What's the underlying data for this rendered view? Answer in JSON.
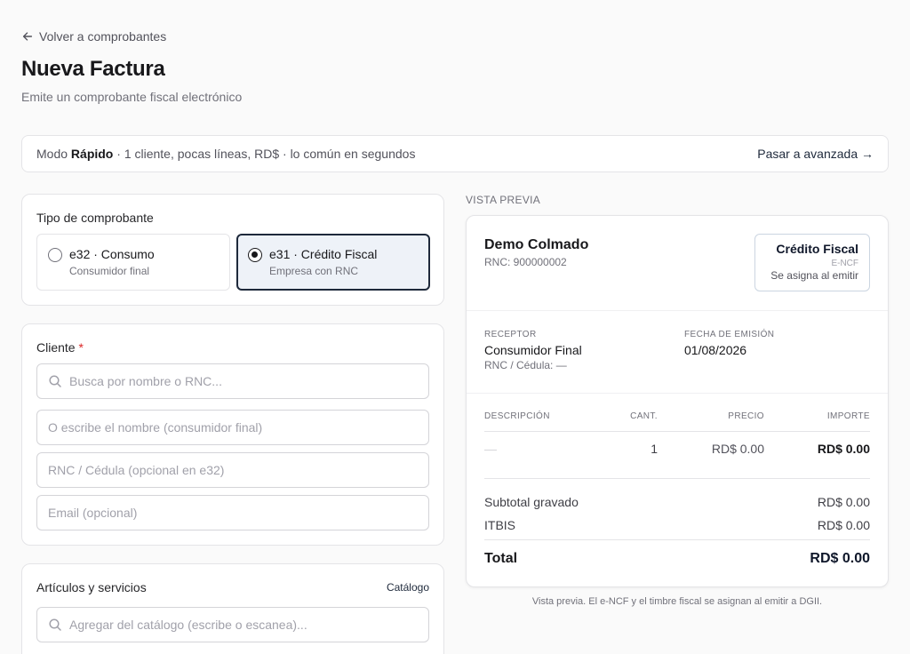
{
  "nav": {
    "back_label": "Volver a comprobantes"
  },
  "page": {
    "title": "Nueva Factura",
    "subtitle": "Emite un comprobante fiscal electrónico"
  },
  "mode": {
    "prefix": "Modo",
    "name": "Rápido",
    "description": "· 1 cliente, pocas líneas, RD$ · lo común en segundos",
    "switch_label": "Pasar a avanzada →"
  },
  "type_section": {
    "label": "Tipo de comprobante",
    "options": [
      {
        "title": "e32 · Consumo",
        "subtitle": "Consumidor final",
        "selected": false
      },
      {
        "title": "e31 · Crédito Fiscal",
        "subtitle": "Empresa con RNC",
        "selected": true
      }
    ]
  },
  "client_section": {
    "label": "Cliente",
    "required_mark": "*",
    "search_placeholder": "Busca por nombre o RNC...",
    "name_placeholder": "O escribe el nombre (consumidor final)",
    "rnc_placeholder": "RNC / Cédula (opcional en e32)",
    "email_placeholder": "Email (opcional)"
  },
  "items_section": {
    "label": "Artículos y servicios",
    "catalog_link": "Catálogo",
    "search_placeholder": "Agregar del catálogo (escribe o escanea)..."
  },
  "preview": {
    "section_label": "VISTA PREVIA",
    "company": "Demo Colmado",
    "company_rnc": "RNC: 900000002",
    "badge_title": "Crédito Fiscal",
    "badge_sub": "E-NCF",
    "badge_note": "Se asigna al emitir",
    "receptor_label": "RECEPTOR",
    "receptor_name": "Consumidor Final",
    "receptor_rnc": "RNC / Cédula: —",
    "fecha_label": "FECHA DE EMISIÓN",
    "fecha_value": "01/08/2026",
    "columns": {
      "desc": "DESCRIPCIÓN",
      "qty": "CANT.",
      "price": "PRECIO",
      "amount": "IMPORTE"
    },
    "row": {
      "desc": "—",
      "qty": "1",
      "price": "RD$ 0.00",
      "amount": "RD$ 0.00"
    },
    "subtotal_label": "Subtotal gravado",
    "subtotal_value": "RD$ 0.00",
    "itbis_label": "ITBIS",
    "itbis_value": "RD$ 0.00",
    "total_label": "Total",
    "total_value": "RD$ 0.00",
    "footnote": "Vista previa. El e-NCF y el timbre fiscal se asignan al emitir a DGII."
  },
  "colors": {
    "accent": "#1e293b",
    "selected_bg": "#eef2f8",
    "required": "#dc2626",
    "border": "#e4e4e7"
  },
  "icons": {
    "back": "arrow-left-icon",
    "search": "search-icon"
  }
}
